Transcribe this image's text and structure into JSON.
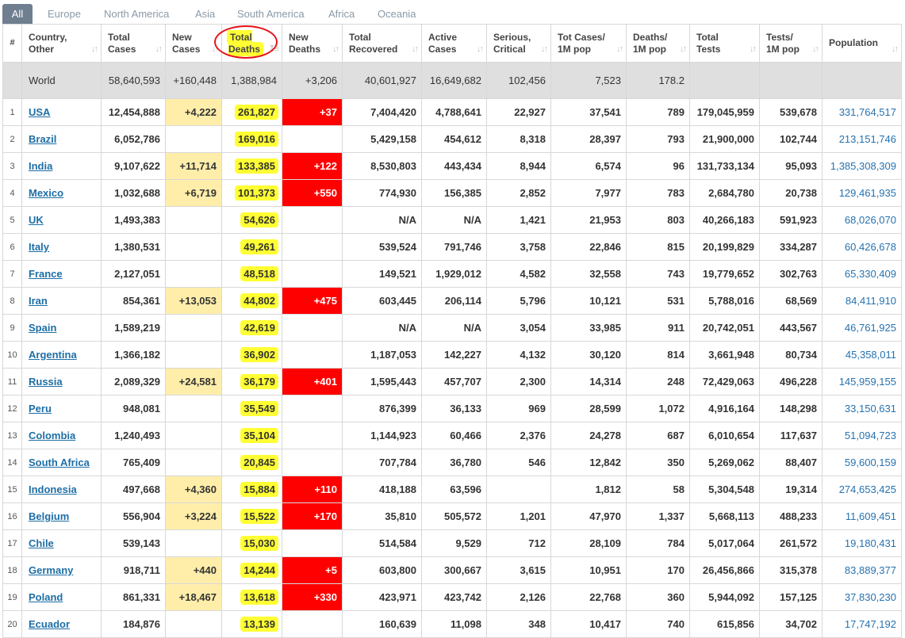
{
  "tabs": [
    "All",
    "Europe",
    "North America",
    "Asia",
    "South America",
    "Africa",
    "Oceania"
  ],
  "active_tab": "All",
  "columns": [
    "#",
    "Country,\nOther",
    "Total\nCases",
    "New\nCases",
    "Total\nDeaths",
    "New\nDeaths",
    "Total\nRecovered",
    "Active\nCases",
    "Serious,\nCritical",
    "Tot Cases/\n1M pop",
    "Deaths/\n1M pop",
    "Total\nTests",
    "Tests/\n1M pop",
    "Population"
  ],
  "world": [
    "",
    "World",
    "58,640,593",
    "+160,448",
    "1,388,984",
    "+3,206",
    "40,601,927",
    "16,649,682",
    "102,456",
    "7,523",
    "178.2",
    "",
    "",
    ""
  ],
  "rows": [
    [
      "1",
      "USA",
      "12,454,888",
      "+4,222",
      "261,827",
      "+37",
      "7,404,420",
      "4,788,641",
      "22,927",
      "37,541",
      "789",
      "179,045,959",
      "539,678",
      "331,764,517"
    ],
    [
      "2",
      "Brazil",
      "6,052,786",
      "",
      "169,016",
      "",
      "5,429,158",
      "454,612",
      "8,318",
      "28,397",
      "793",
      "21,900,000",
      "102,744",
      "213,151,746"
    ],
    [
      "3",
      "India",
      "9,107,622",
      "+11,714",
      "133,385",
      "+122",
      "8,530,803",
      "443,434",
      "8,944",
      "6,574",
      "96",
      "131,733,134",
      "95,093",
      "1,385,308,309"
    ],
    [
      "4",
      "Mexico",
      "1,032,688",
      "+6,719",
      "101,373",
      "+550",
      "774,930",
      "156,385",
      "2,852",
      "7,977",
      "783",
      "2,684,780",
      "20,738",
      "129,461,935"
    ],
    [
      "5",
      "UK",
      "1,493,383",
      "",
      "54,626",
      "",
      "N/A",
      "N/A",
      "1,421",
      "21,953",
      "803",
      "40,266,183",
      "591,923",
      "68,026,070"
    ],
    [
      "6",
      "Italy",
      "1,380,531",
      "",
      "49,261",
      "",
      "539,524",
      "791,746",
      "3,758",
      "22,846",
      "815",
      "20,199,829",
      "334,287",
      "60,426,678"
    ],
    [
      "7",
      "France",
      "2,127,051",
      "",
      "48,518",
      "",
      "149,521",
      "1,929,012",
      "4,582",
      "32,558",
      "743",
      "19,779,652",
      "302,763",
      "65,330,409"
    ],
    [
      "8",
      "Iran",
      "854,361",
      "+13,053",
      "44,802",
      "+475",
      "603,445",
      "206,114",
      "5,796",
      "10,121",
      "531",
      "5,788,016",
      "68,569",
      "84,411,910"
    ],
    [
      "9",
      "Spain",
      "1,589,219",
      "",
      "42,619",
      "",
      "N/A",
      "N/A",
      "3,054",
      "33,985",
      "911",
      "20,742,051",
      "443,567",
      "46,761,925"
    ],
    [
      "10",
      "Argentina",
      "1,366,182",
      "",
      "36,902",
      "",
      "1,187,053",
      "142,227",
      "4,132",
      "30,120",
      "814",
      "3,661,948",
      "80,734",
      "45,358,011"
    ],
    [
      "11",
      "Russia",
      "2,089,329",
      "+24,581",
      "36,179",
      "+401",
      "1,595,443",
      "457,707",
      "2,300",
      "14,314",
      "248",
      "72,429,063",
      "496,228",
      "145,959,155"
    ],
    [
      "12",
      "Peru",
      "948,081",
      "",
      "35,549",
      "",
      "876,399",
      "36,133",
      "969",
      "28,599",
      "1,072",
      "4,916,164",
      "148,298",
      "33,150,631"
    ],
    [
      "13",
      "Colombia",
      "1,240,493",
      "",
      "35,104",
      "",
      "1,144,923",
      "60,466",
      "2,376",
      "24,278",
      "687",
      "6,010,654",
      "117,637",
      "51,094,723"
    ],
    [
      "14",
      "South Africa",
      "765,409",
      "",
      "20,845",
      "",
      "707,784",
      "36,780",
      "546",
      "12,842",
      "350",
      "5,269,062",
      "88,407",
      "59,600,159"
    ],
    [
      "15",
      "Indonesia",
      "497,668",
      "+4,360",
      "15,884",
      "+110",
      "418,188",
      "63,596",
      "",
      "1,812",
      "58",
      "5,304,548",
      "19,314",
      "274,653,425"
    ],
    [
      "16",
      "Belgium",
      "556,904",
      "+3,224",
      "15,522",
      "+170",
      "35,810",
      "505,572",
      "1,201",
      "47,970",
      "1,337",
      "5,668,113",
      "488,233",
      "11,609,451"
    ],
    [
      "17",
      "Chile",
      "539,143",
      "",
      "15,030",
      "",
      "514,584",
      "9,529",
      "712",
      "28,109",
      "784",
      "5,017,064",
      "261,572",
      "19,180,431"
    ],
    [
      "18",
      "Germany",
      "918,711",
      "+440",
      "14,244",
      "+5",
      "603,800",
      "300,667",
      "3,615",
      "10,951",
      "170",
      "26,456,866",
      "315,378",
      "83,889,377"
    ],
    [
      "19",
      "Poland",
      "861,331",
      "+18,467",
      "13,618",
      "+330",
      "423,971",
      "423,742",
      "2,126",
      "22,768",
      "360",
      "5,944,092",
      "157,125",
      "37,830,230"
    ],
    [
      "20",
      "Ecuador",
      "184,876",
      "",
      "13,139",
      "",
      "160,639",
      "11,098",
      "348",
      "10,417",
      "740",
      "615,856",
      "34,702",
      "17,747,192"
    ]
  ],
  "colors": {
    "new_cases_bg": "#ffeeaa",
    "new_deaths_bg": "#ff0000",
    "highlight": "#ffff33",
    "annotation_circle": "#e5141a",
    "link": "#1d6ea5",
    "world_row_bg": "#dfdfdf"
  },
  "annotations": {
    "circled_column": "Total Deaths",
    "highlighted_column": "Total Deaths"
  },
  "icons": {
    "sort": "sort-arrows-icon",
    "sort_active": "sort-desc-icon"
  }
}
